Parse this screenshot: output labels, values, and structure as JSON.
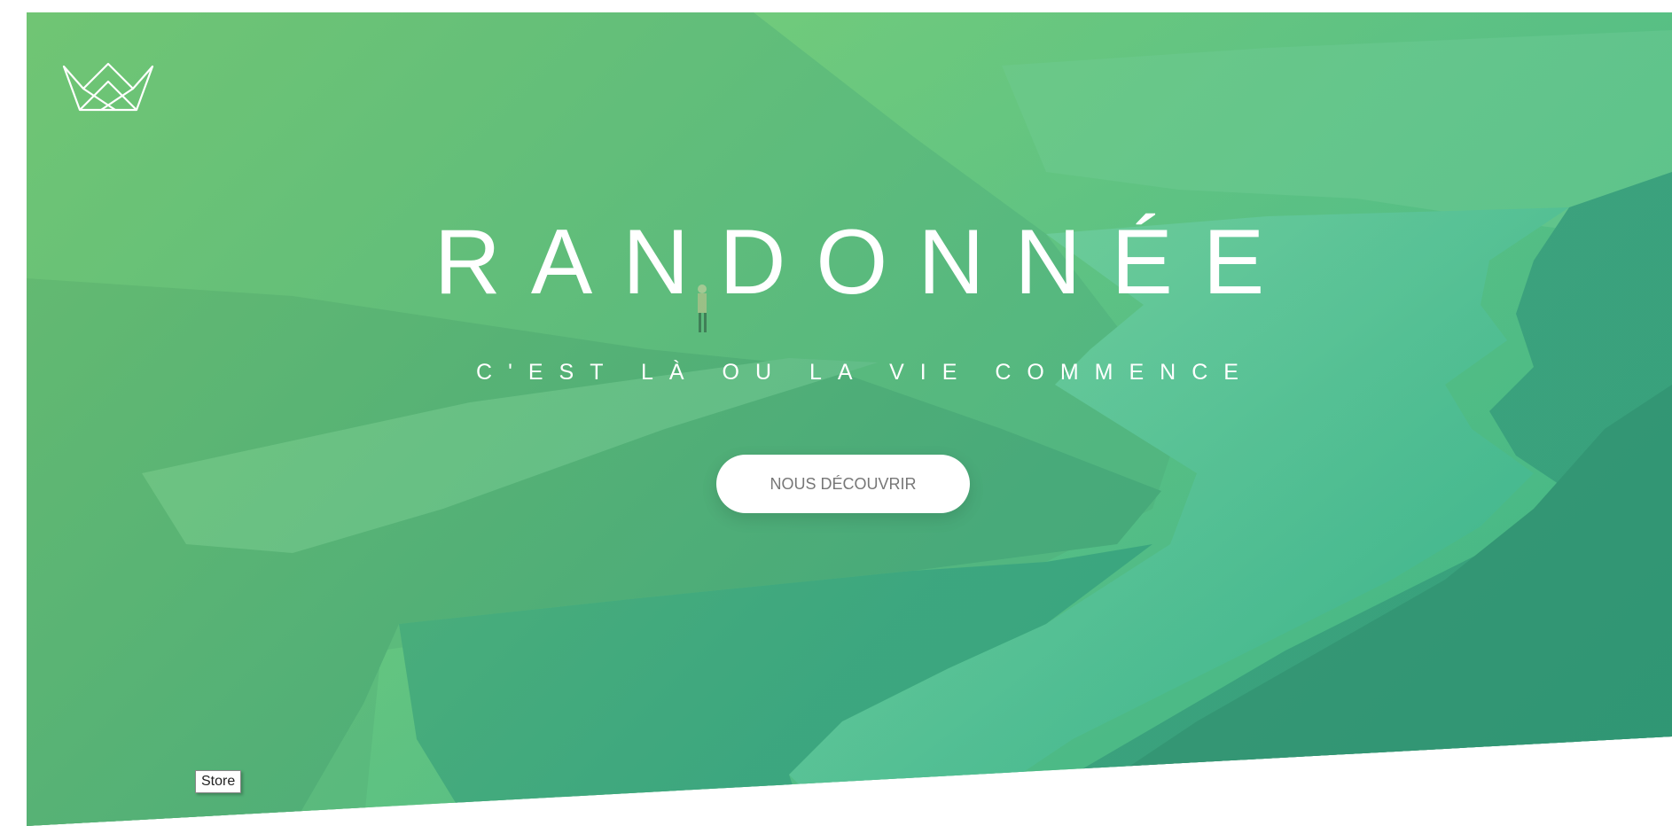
{
  "hero": {
    "title": "RANDONNÉE",
    "subtitle": "C'EST LÀ OU LA VIE COMMENCE",
    "cta_label": "NOUS DÉCOUVRIR",
    "logo_icon": "crown-logo-icon",
    "gradient_colors": [
      "#7ed56f",
      "#28b485"
    ]
  },
  "tooltip": {
    "text": "Store"
  }
}
